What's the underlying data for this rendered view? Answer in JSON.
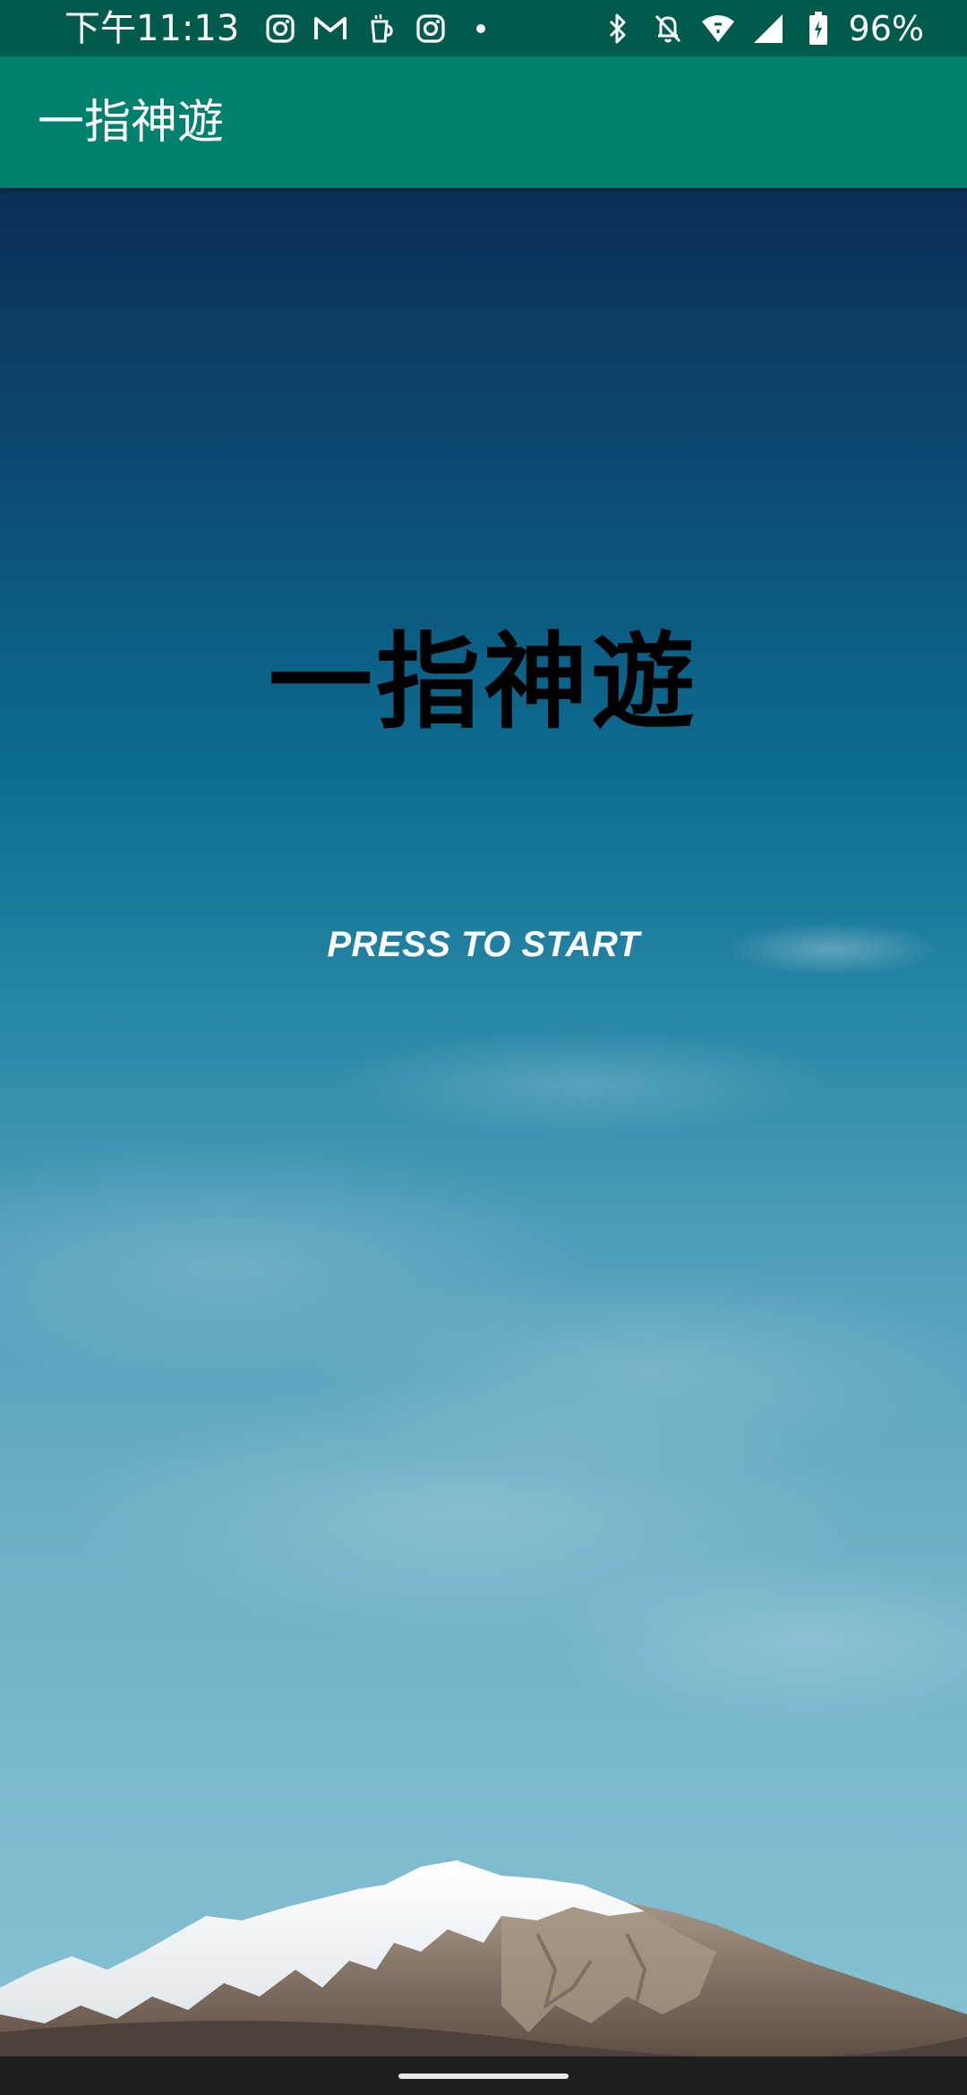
{
  "status_bar": {
    "time": "下午11:13",
    "battery_percent": "96%",
    "left_icons": [
      "instagram-icon",
      "gmail-icon",
      "cup-icon",
      "instagram-icon",
      "dot-icon"
    ],
    "right_icons": [
      "bluetooth-icon",
      "bell-off-icon",
      "wifi-icon",
      "signal-icon",
      "battery-charging-icon"
    ],
    "background": "#005b4c"
  },
  "app_bar": {
    "title": "一指神遊",
    "background": "#00806d"
  },
  "main": {
    "title": "一指神遊",
    "start_label": "PRESS TO START"
  },
  "nav_bar": {
    "background": "#1f1f1f"
  }
}
